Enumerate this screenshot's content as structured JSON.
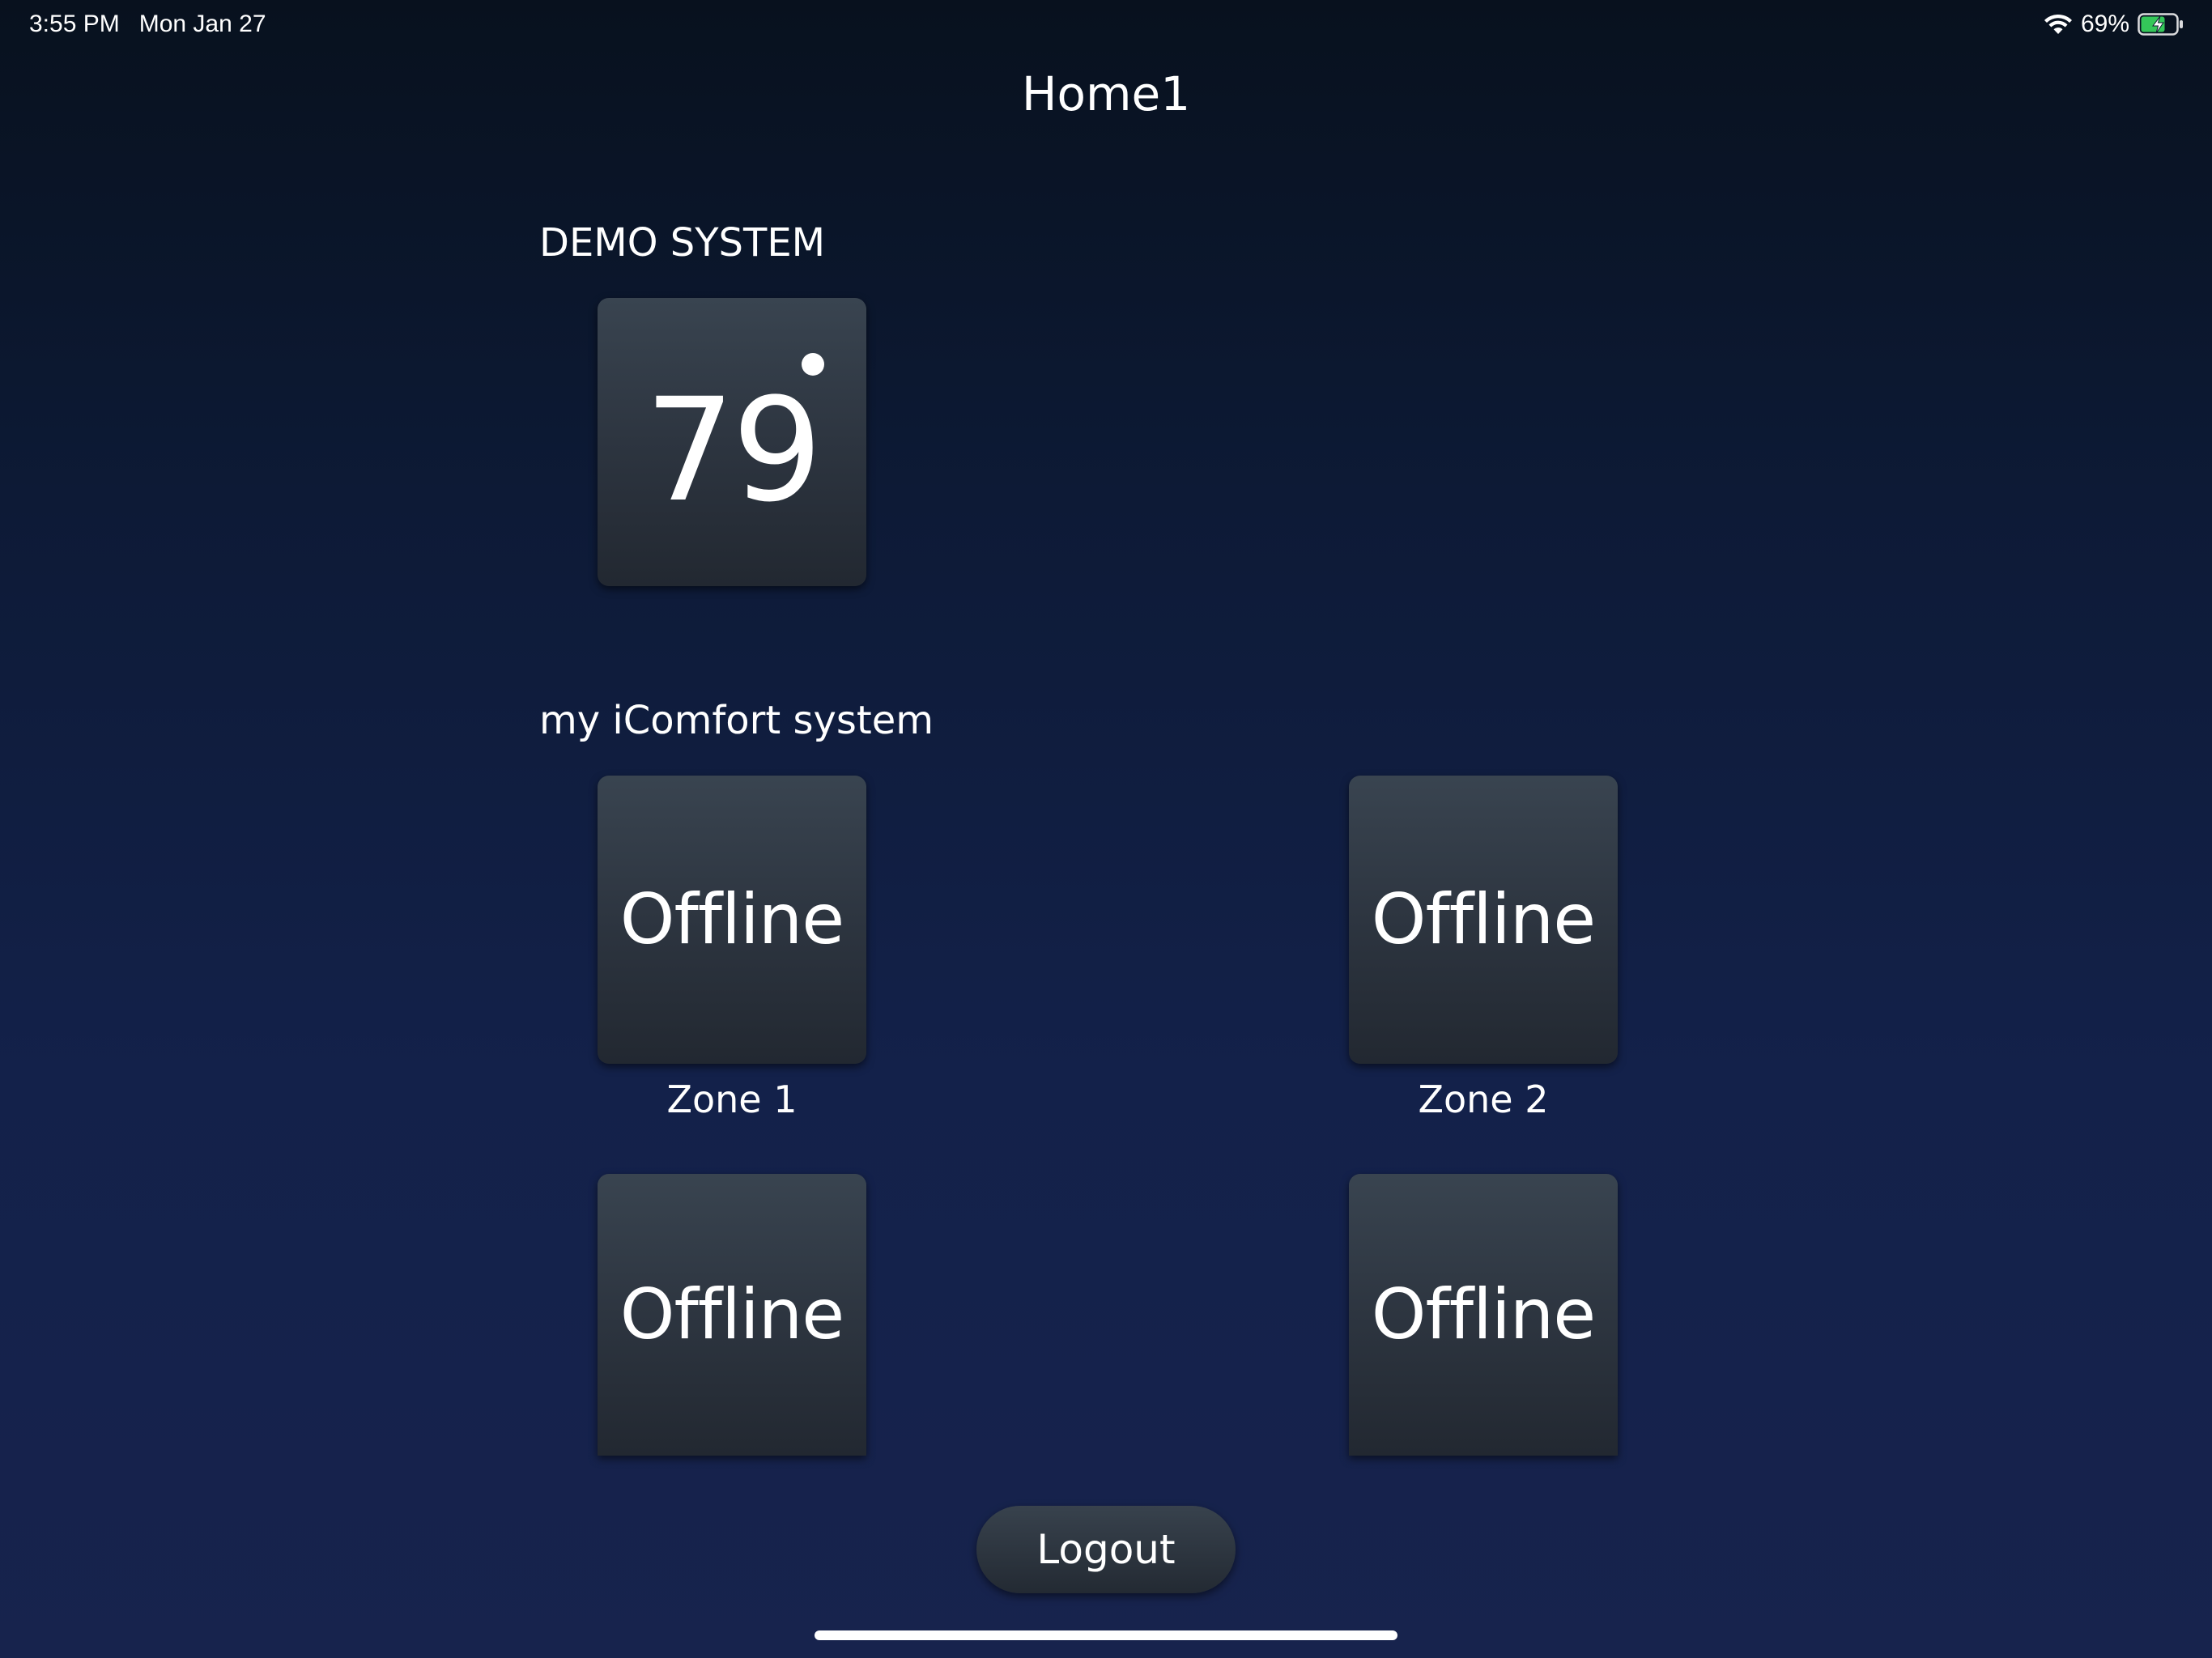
{
  "status_bar": {
    "time": "3:55 PM",
    "date": "Mon Jan 27",
    "battery_percent": "69%",
    "battery_level": 0.69,
    "battery_charging": true,
    "battery_color": "#34c759"
  },
  "header": {
    "title": "Home1"
  },
  "sections": {
    "demo": {
      "title": "DEMO SYSTEM",
      "tile": {
        "temperature": "79"
      }
    },
    "icomfort": {
      "title": "my iComfort system",
      "zones": [
        {
          "status": "Offline",
          "label": "Zone 1"
        },
        {
          "status": "Offline",
          "label": "Zone 2"
        },
        {
          "status": "Offline"
        },
        {
          "status": "Offline"
        }
      ]
    }
  },
  "actions": {
    "logout_label": "Logout"
  },
  "colors": {
    "background_top": "#08111e",
    "background_bottom": "#17234d",
    "tile_top": "#394450",
    "tile_bottom": "#222831"
  }
}
